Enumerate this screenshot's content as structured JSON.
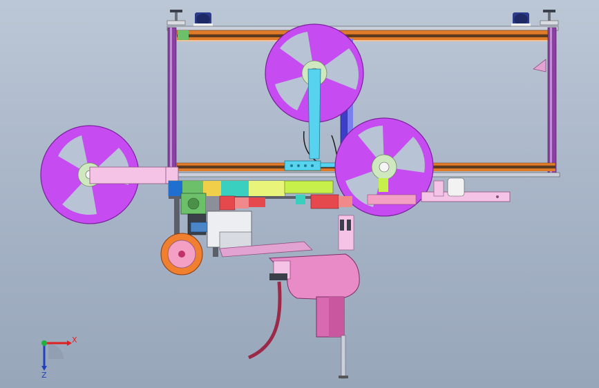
{
  "triad": {
    "x_label": "X",
    "z_label": "Z",
    "colors": {
      "x": "#e02020",
      "z": "#2040c0",
      "y": "#20b040"
    }
  },
  "colors": {
    "reel": "#c64bf0",
    "reel_stroke": "#7a1f9c",
    "frame_purple": "#8a3fa3",
    "frame_orange": "#e07b2a",
    "arm_cyan": "#57d3f0",
    "arm_pink": "#f4c3e6",
    "feeder_pink": "#e88bc7",
    "motor_red": "#e5484d",
    "wheel_orange": "#f07f2f",
    "lime": "#c8f04a",
    "green": "#6cc06a"
  }
}
